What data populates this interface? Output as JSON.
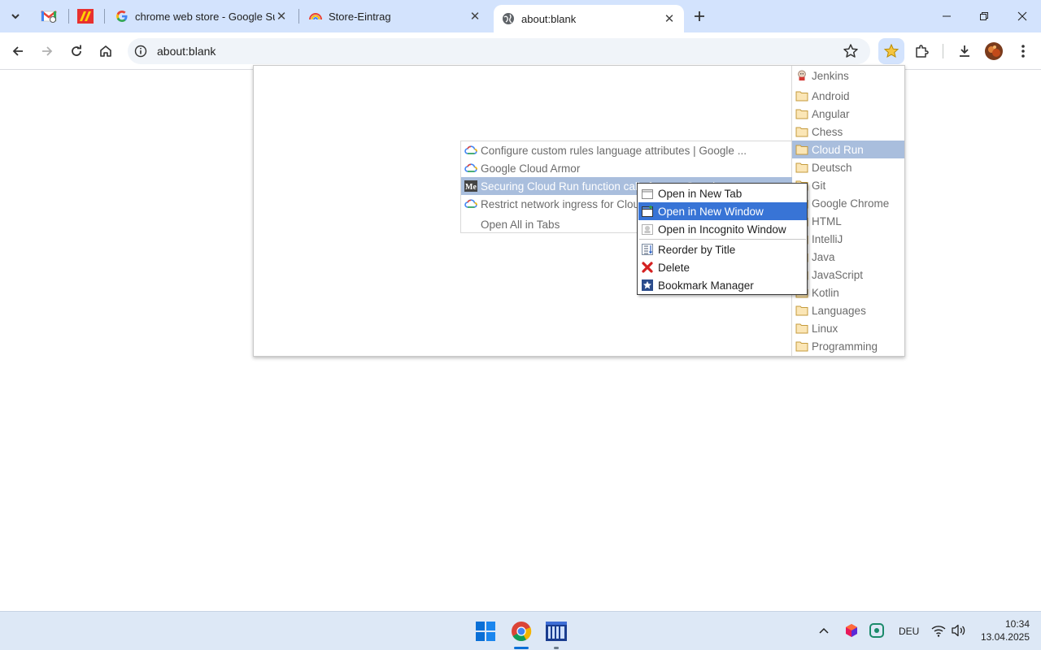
{
  "tabs": [
    {
      "title": "chrome web store - Google Suc",
      "icon": "google-g-icon"
    },
    {
      "title": "Store-Eintrag",
      "icon": "rainbow-icon"
    },
    {
      "title": "about:blank",
      "icon": "globe-icon",
      "active": true
    }
  ],
  "address_bar": {
    "url": "about:blank"
  },
  "folders": [
    {
      "label": "Jenkins",
      "icon": "jenkins-icon"
    },
    {
      "label": "Android"
    },
    {
      "label": "Angular"
    },
    {
      "label": "Chess"
    },
    {
      "label": "Cloud Run",
      "selected": true
    },
    {
      "label": "Deutsch"
    },
    {
      "label": "Git"
    },
    {
      "label": "Google Chrome"
    },
    {
      "label": "HTML"
    },
    {
      "label": "IntelliJ"
    },
    {
      "label": "Java"
    },
    {
      "label": "JavaScript"
    },
    {
      "label": "Kotlin"
    },
    {
      "label": "Languages"
    },
    {
      "label": "Linux"
    },
    {
      "label": "Programming"
    }
  ],
  "bookmarks": [
    {
      "label": "Configure custom rules language attributes  |  Google ...",
      "icon": "google-cloud-icon"
    },
    {
      "label": "Google Cloud Armor",
      "icon": "google-cloud-icon"
    },
    {
      "label": "Securing Cloud Run function calls from ... Google ...",
      "icon": "medium-icon",
      "selected": true
    },
    {
      "label": "Restrict network ingress for Cloud Run",
      "icon": "google-cloud-icon"
    }
  ],
  "open_all_label": "Open All in Tabs",
  "context_menu": [
    {
      "label": "Open in New Tab",
      "icon": "new-tab-icon"
    },
    {
      "label": "Open in New Window",
      "icon": "new-window-icon",
      "selected": true
    },
    {
      "label": "Open in Incognito Window",
      "icon": "incognito-icon"
    },
    {
      "label": "Reorder by Title",
      "icon": "reorder-icon"
    },
    {
      "label": "Delete",
      "icon": "delete-icon"
    },
    {
      "label": "Bookmark Manager",
      "icon": "bookmark-manager-icon"
    }
  ],
  "taskbar": {
    "language": "DEU",
    "time": "10:34",
    "date": "13.04.2025"
  },
  "colors": {
    "tabstrip": "#d3e3fd",
    "selection_light": "#a9bedd",
    "selection_dark": "#3874d6",
    "taskbar": "#dde8f6"
  }
}
